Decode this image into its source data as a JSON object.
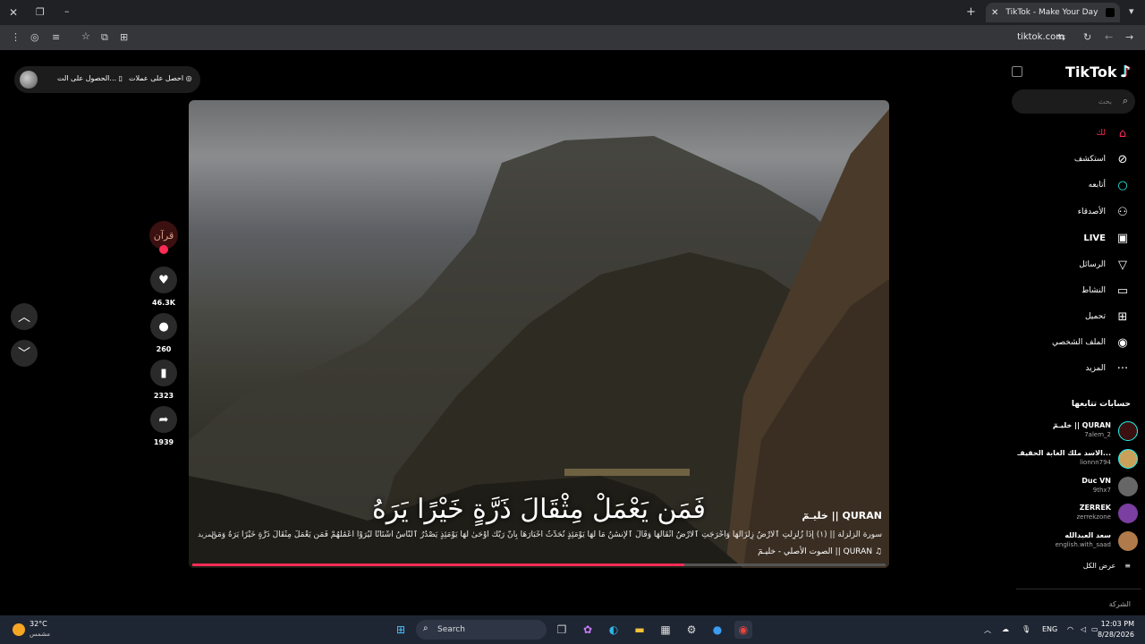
{
  "browser": {
    "tab_title": "TikTok - Make Your Day",
    "url": "tiktok.com"
  },
  "topbar": {
    "coins_label": "احصل على عملات",
    "app_label": "الحصول على الت..."
  },
  "video": {
    "verse": "فَمَن يَعْمَلْ مِثْقَالَ ذَرَّةٍ خَيْرًا يَرَهُ",
    "author": "خليـمٓ || QURAN",
    "description": "سورة الزلزلة || (١) إِذَا زُلْزِلَتِ ٱلْأَرْضُ زِلْزَالَهَا وَأَخْرَجَتِ ٱلْأَرْضُ أَثْقَالَهَا وَقَالَ ٱلْإِنسَٰنُ مَا لَهَا يَوْمَئِذٍ تُحَدِّثُ أَخْبَارَهَا بِأَنَّ رَبَّكَ أَوْحَىٰ لَهَا يَوْمَئِذٍ يَصْدُرُ ٱلنَّاسُ أَشْتَاتًا لِّيُرَوْا أَعْمَٰلَهُمْ فَمَن يَعْمَلْ مِثْقَالَ ذَرَّةٍ خَيْرًا يَرَهُ وَمَن",
    "more_label": "المزيد",
    "music": "♫ QURAN || الصوت الأصلي - خليـمٓ",
    "progress": 0.71
  },
  "actions": {
    "creator_avatar_text": "قرآن",
    "likes": "46.3K",
    "comments": "260",
    "saves": "2323",
    "shares": "1939"
  },
  "sidebar": {
    "logo": "TikTok",
    "search_placeholder": "بحث",
    "nav": [
      {
        "label": "لك",
        "icon": "home-icon",
        "active": true
      },
      {
        "label": "استكشف",
        "icon": "compass-icon"
      },
      {
        "label": "أتابعه",
        "icon": "following-icon"
      },
      {
        "label": "الأصدقاء",
        "icon": "friends-icon"
      },
      {
        "label": "LIVE",
        "icon": "live-icon"
      },
      {
        "label": "الرسائل",
        "icon": "messages-icon"
      },
      {
        "label": "النشاط",
        "icon": "activity-icon"
      },
      {
        "label": "تحميل",
        "icon": "upload-icon"
      },
      {
        "label": "الملف الشخصي",
        "icon": "profile-icon"
      },
      {
        "label": "المزيد",
        "icon": "more-icon"
      }
    ],
    "following_title": "حسابات تتابعها",
    "accounts": [
      {
        "name": "خليـمٓ || QURAN",
        "handle": "7alem_2",
        "color": "#3a1010"
      },
      {
        "name": "الاسد ملك الغابة الحقيقـ...",
        "handle": "lionnn794",
        "color": "#c9a15b"
      },
      {
        "name": "Duc VN",
        "handle": "9thx7",
        "color": "#666"
      },
      {
        "name": "ZERREK",
        "handle": "zerrekzone",
        "color": "#7a3fa0"
      },
      {
        "name": "سعد العبدالله",
        "handle": "english.with_saad",
        "color": "#b07a4a"
      }
    ],
    "see_all": "عرض الكل",
    "company": "الشركة"
  },
  "taskbar": {
    "temp": "32°C",
    "weather": "مشمس",
    "search": "Search",
    "lang": "ENG",
    "time": "12:03 PM",
    "date": "8/28/2026"
  }
}
